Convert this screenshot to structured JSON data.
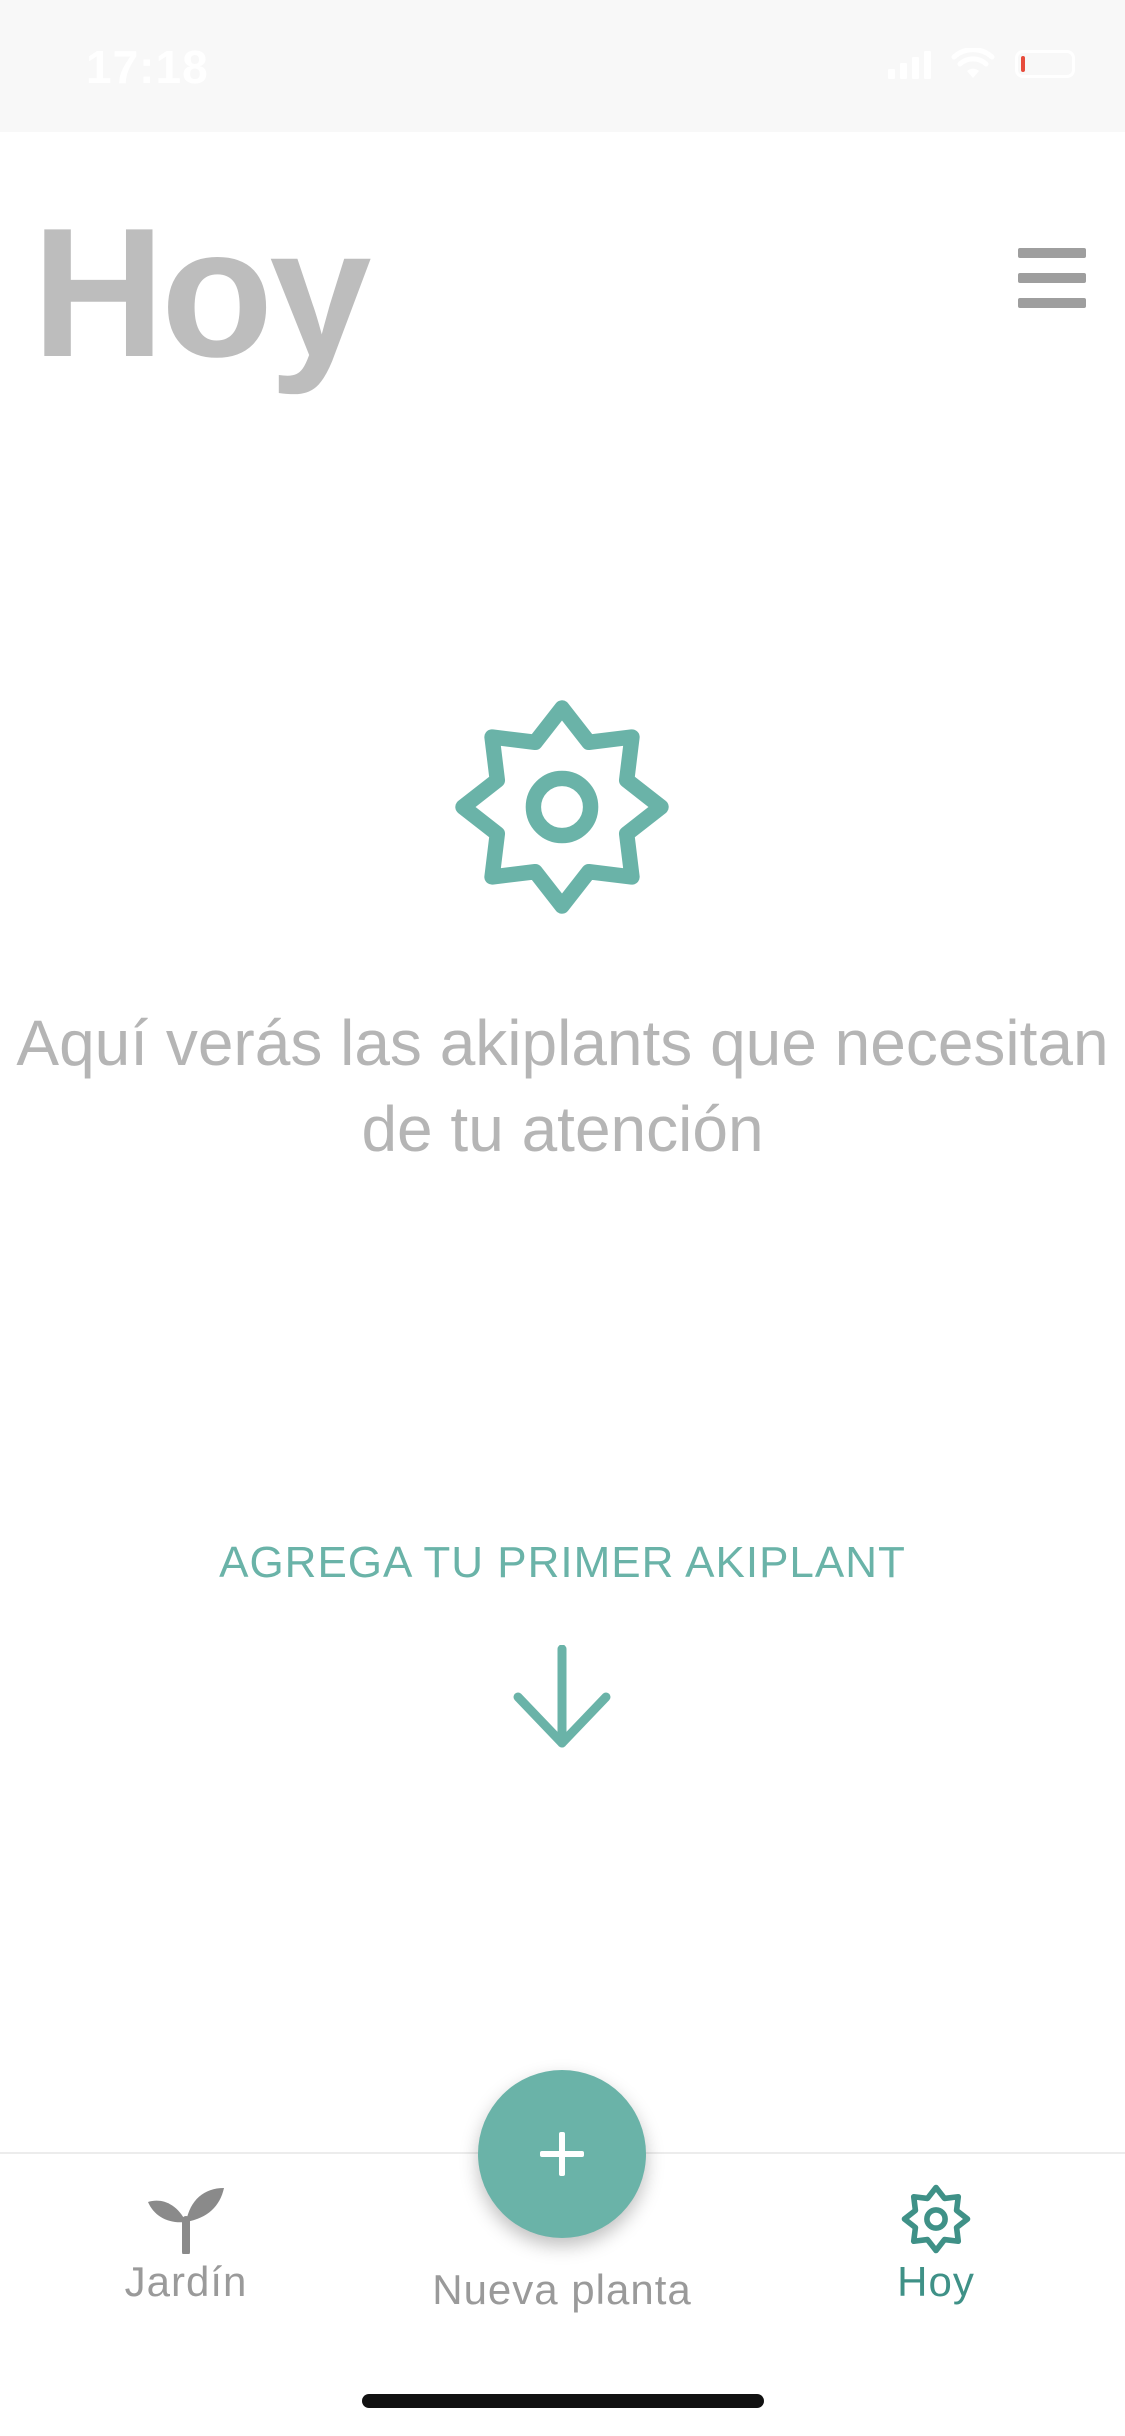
{
  "status_bar": {
    "time": "17:18",
    "battery_level_color": "#e74c3c"
  },
  "header": {
    "title": "Hoy",
    "menu_icon": "hamburger-menu-icon"
  },
  "empty_state": {
    "icon": "sun-gear-icon",
    "message": "Aquí verás las akiplants que necesitan de tu atención",
    "cta": "AGREGA TU PRIMER AKIPLANT",
    "cta_icon": "arrow-down-icon"
  },
  "tab_bar": {
    "tabs": [
      {
        "label": "Jardín",
        "icon": "sprout-icon",
        "active": false
      },
      {
        "label": "Nueva planta",
        "icon": "plus-icon",
        "active": false
      },
      {
        "label": "Hoy",
        "icon": "sun-gear-icon",
        "active": true
      }
    ]
  },
  "colors": {
    "accent": "#6ab3a8",
    "accent_dark": "#3f9187",
    "title_gray": "#bdbdbd",
    "text_gray": "#b5b5b5",
    "tab_gray": "#9a9a9a"
  }
}
